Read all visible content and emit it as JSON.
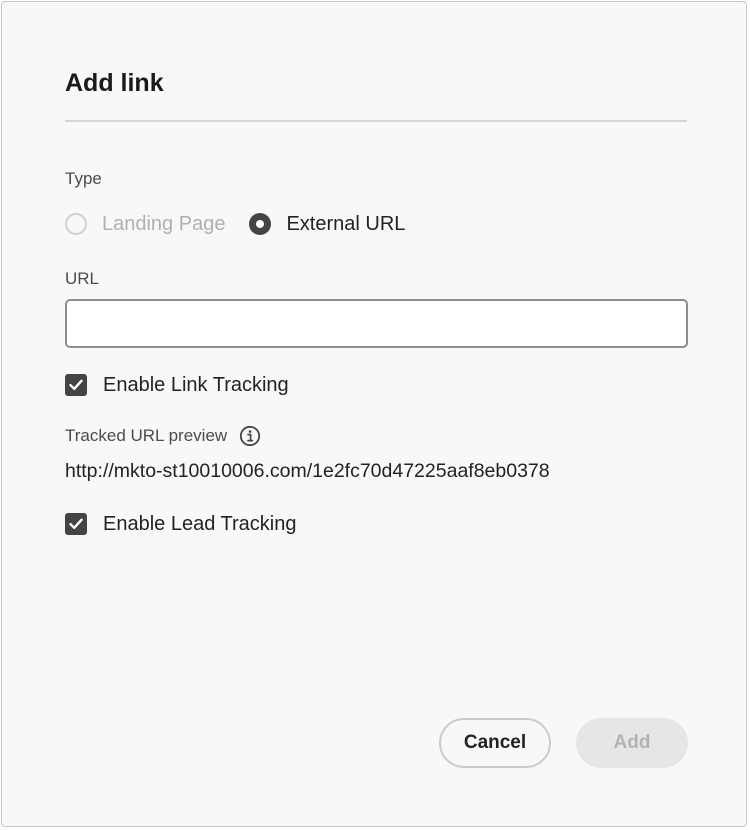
{
  "dialog": {
    "title": "Add link"
  },
  "type_field": {
    "label": "Type",
    "options": [
      {
        "label": "Landing Page",
        "selected": false,
        "disabled": true
      },
      {
        "label": "External URL",
        "selected": true,
        "disabled": false
      }
    ]
  },
  "url_field": {
    "label": "URL",
    "value": "",
    "placeholder": ""
  },
  "link_tracking": {
    "label": "Enable Link Tracking",
    "checked": true
  },
  "tracked_preview": {
    "label": "Tracked URL preview",
    "icon": "info-icon",
    "value": "http://mkto-st10010006.com/1e2fc70d47225aaf8eb0378"
  },
  "lead_tracking": {
    "label": "Enable Lead Tracking",
    "checked": true
  },
  "footer": {
    "cancel_label": "Cancel",
    "add_label": "Add"
  },
  "colors": {
    "control": "#444444",
    "disabled_text": "#b0b0b0",
    "background": "#f8f8f8"
  }
}
